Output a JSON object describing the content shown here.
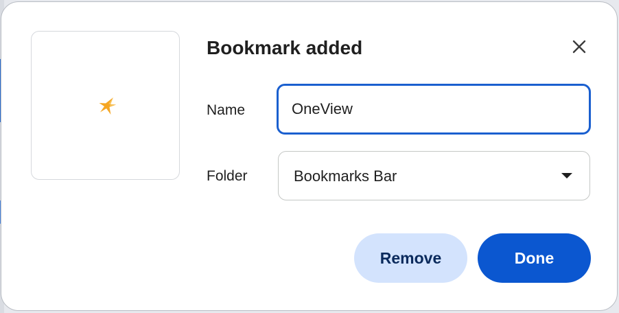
{
  "dialog": {
    "title": "Bookmark added",
    "close_icon": "close-icon",
    "preview_icon": "star-favicon-icon"
  },
  "fields": {
    "name_label": "Name",
    "name_value": "OneView",
    "folder_label": "Folder",
    "folder_value": "Bookmarks Bar",
    "folder_icon": "chevron-down-icon"
  },
  "actions": {
    "remove_label": "Remove",
    "done_label": "Done"
  },
  "colors": {
    "accent": "#0b57d0",
    "accent_light": "#d3e3fd",
    "focus_border": "#1a5fcf",
    "favicon": "#f5a623"
  }
}
